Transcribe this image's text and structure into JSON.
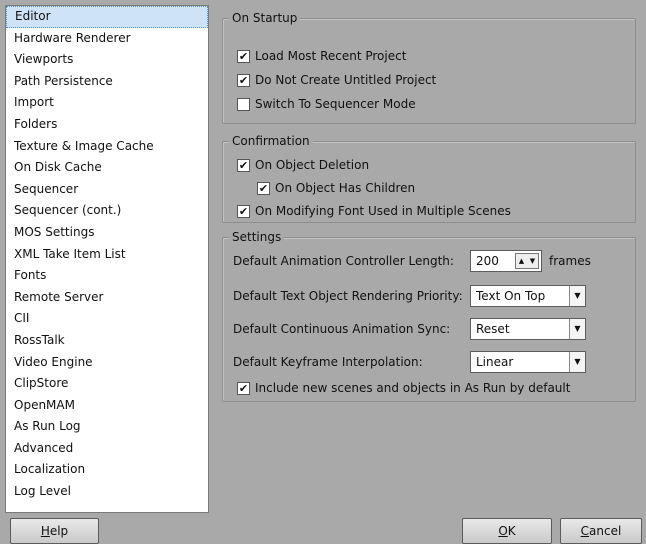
{
  "sidebar": {
    "items": [
      {
        "label": "Editor"
      },
      {
        "label": "Hardware Renderer"
      },
      {
        "label": "Viewports"
      },
      {
        "label": "Path Persistence"
      },
      {
        "label": "Import"
      },
      {
        "label": "Folders"
      },
      {
        "label": "Texture & Image Cache"
      },
      {
        "label": "On Disk Cache"
      },
      {
        "label": "Sequencer"
      },
      {
        "label": "Sequencer (cont.)"
      },
      {
        "label": "MOS Settings"
      },
      {
        "label": "XML Take Item List"
      },
      {
        "label": "Fonts"
      },
      {
        "label": "Remote Server"
      },
      {
        "label": "CII"
      },
      {
        "label": "RossTalk"
      },
      {
        "label": "Video Engine"
      },
      {
        "label": "ClipStore"
      },
      {
        "label": "OpenMAM"
      },
      {
        "label": "As Run Log"
      },
      {
        "label": "Advanced"
      },
      {
        "label": "Localization"
      },
      {
        "label": "Log Level"
      }
    ]
  },
  "startup": {
    "title": "On Startup",
    "load_recent": "Load Most Recent Project",
    "no_untitled": "Do Not Create Untitled Project",
    "sequencer_mode": "Switch To Sequencer Mode"
  },
  "confirmation": {
    "title": "Confirmation",
    "object_deletion": "On Object Deletion",
    "has_children": "On Object Has Children",
    "font_multiple": "On Modifying Font Used in Multiple Scenes"
  },
  "settings": {
    "title": "Settings",
    "controller_length_label": "Default Animation Controller Length:",
    "controller_length_value": "200",
    "frames_label": "frames",
    "render_priority_label": "Default Text Object Rendering Priority:",
    "render_priority_value": "Text On Top",
    "anim_sync_label": "Default Continuous Animation Sync:",
    "anim_sync_value": "Reset",
    "interp_label": "Default Keyframe Interpolation:",
    "interp_value": "Linear",
    "as_run": "Include new scenes and objects in As Run by default"
  },
  "buttons": {
    "help_first": "H",
    "help_rest": "elp",
    "ok_first": "O",
    "ok_rest": "K",
    "cancel_first": "C",
    "cancel_rest": "ancel"
  },
  "colors": {
    "background": "#a9a9a9",
    "selection": "#cfe3f8"
  }
}
